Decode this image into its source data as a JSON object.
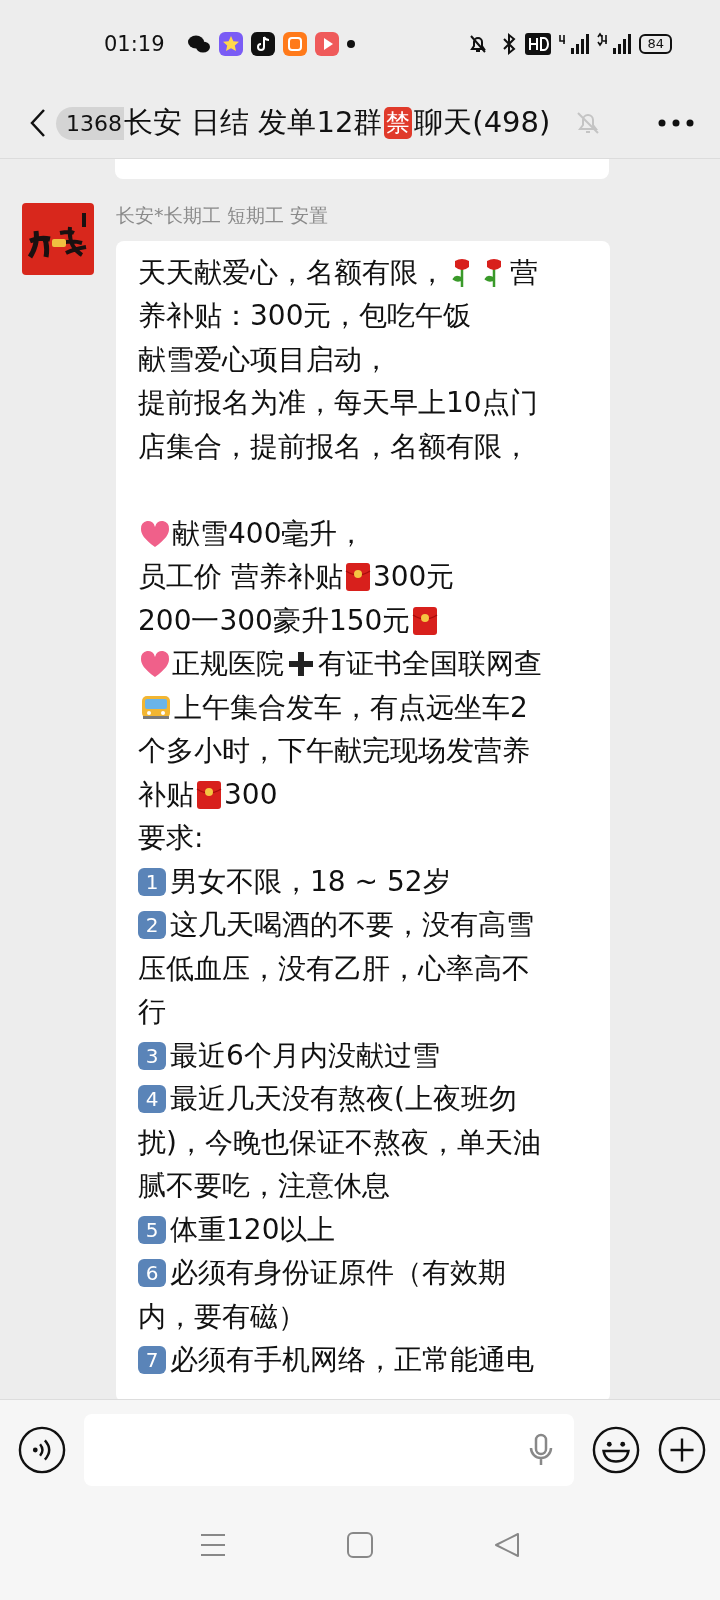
{
  "status_bar": {
    "time": "01:19",
    "battery": "84"
  },
  "header": {
    "unread_count": "1368",
    "title": [
      {
        "kind": "text",
        "text": "长安 日结 发单12群"
      },
      {
        "kind": "tag",
        "text": "禁"
      },
      {
        "kind": "text",
        "text": "聊天(498)"
      }
    ],
    "muted": true
  },
  "message": {
    "sender": "长安*长期工 短期工 安置",
    "lines": [
      {
        "segments": [
          {
            "kind": "text",
            "text": "天天献爱心，名额有限，"
          },
          {
            "kind": "rose"
          },
          {
            "kind": "rose"
          },
          {
            "kind": "text",
            "text": "营"
          }
        ]
      },
      {
        "segments": [
          {
            "kind": "text",
            "text": "养补贴：300元，包吃午饭"
          }
        ]
      },
      {
        "segments": [
          {
            "kind": "text",
            "text": "献雪爱心项目启动，"
          }
        ]
      },
      {
        "segments": [
          {
            "kind": "text",
            "text": "提前报名为准，每天早上10点门"
          }
        ]
      },
      {
        "segments": [
          {
            "kind": "text",
            "text": "店集合，提前报名，名额有限，"
          }
        ]
      },
      {
        "gap_before": true,
        "segments": [
          {
            "kind": "heart"
          },
          {
            "kind": "text",
            "text": "献雪400毫升，"
          }
        ]
      },
      {
        "segments": [
          {
            "kind": "text",
            "text": "员工价 营养补贴"
          },
          {
            "kind": "envelope"
          },
          {
            "kind": "text",
            "text": "300元"
          }
        ]
      },
      {
        "segments": [
          {
            "kind": "text",
            "text": "200一300豪升150元"
          },
          {
            "kind": "envelope"
          }
        ]
      },
      {
        "segments": [
          {
            "kind": "heart"
          },
          {
            "kind": "text",
            "text": "正规医院"
          },
          {
            "kind": "cross"
          },
          {
            "kind": "text",
            "text": "有证书全国联网查"
          }
        ]
      },
      {
        "segments": [
          {
            "kind": "bus"
          },
          {
            "kind": "text",
            "text": "上午集合发车，有点远坐车2"
          }
        ]
      },
      {
        "segments": [
          {
            "kind": "text",
            "text": "个多小时，下午献完现场发营养"
          }
        ]
      },
      {
        "segments": [
          {
            "kind": "text",
            "text": "补贴"
          },
          {
            "kind": "envelope"
          },
          {
            "kind": "text",
            "text": "300"
          }
        ]
      },
      {
        "segments": [
          {
            "kind": "text",
            "text": "要求:"
          }
        ]
      },
      {
        "segments": [
          {
            "kind": "keycap",
            "text": "1"
          },
          {
            "kind": "text",
            "text": "男女不限，18 ~ 52岁"
          }
        ]
      },
      {
        "segments": [
          {
            "kind": "keycap",
            "text": "2"
          },
          {
            "kind": "text",
            "text": "这几天喝酒的不要，没有高雪"
          }
        ]
      },
      {
        "segments": [
          {
            "kind": "text",
            "text": "压低血压，没有乙肝，心率高不"
          }
        ]
      },
      {
        "segments": [
          {
            "kind": "text",
            "text": "行"
          }
        ]
      },
      {
        "segments": [
          {
            "kind": "keycap",
            "text": "3"
          },
          {
            "kind": "text",
            "text": "最近6个月内没献过雪"
          }
        ]
      },
      {
        "segments": [
          {
            "kind": "keycap",
            "text": "4"
          },
          {
            "kind": "text",
            "text": "最近几天没有熬夜(上夜班勿"
          }
        ]
      },
      {
        "segments": [
          {
            "kind": "text",
            "text": "扰)，今晚也保证不熬夜，单天油"
          }
        ]
      },
      {
        "segments": [
          {
            "kind": "text",
            "text": "腻不要吃，注意休息"
          }
        ]
      },
      {
        "segments": [
          {
            "kind": "keycap",
            "text": "5"
          },
          {
            "kind": "text",
            "text": "体重120以上"
          }
        ]
      },
      {
        "segments": [
          {
            "kind": "keycap",
            "text": "6"
          },
          {
            "kind": "text",
            "text": "必须有身份证原件（有效期"
          }
        ]
      },
      {
        "segments": [
          {
            "kind": "text",
            "text": "内，要有磁）"
          }
        ]
      },
      {
        "segments": [
          {
            "kind": "keycap",
            "text": "7"
          },
          {
            "kind": "text",
            "text": "必须有手机网络，正常能通电"
          }
        ]
      }
    ]
  }
}
